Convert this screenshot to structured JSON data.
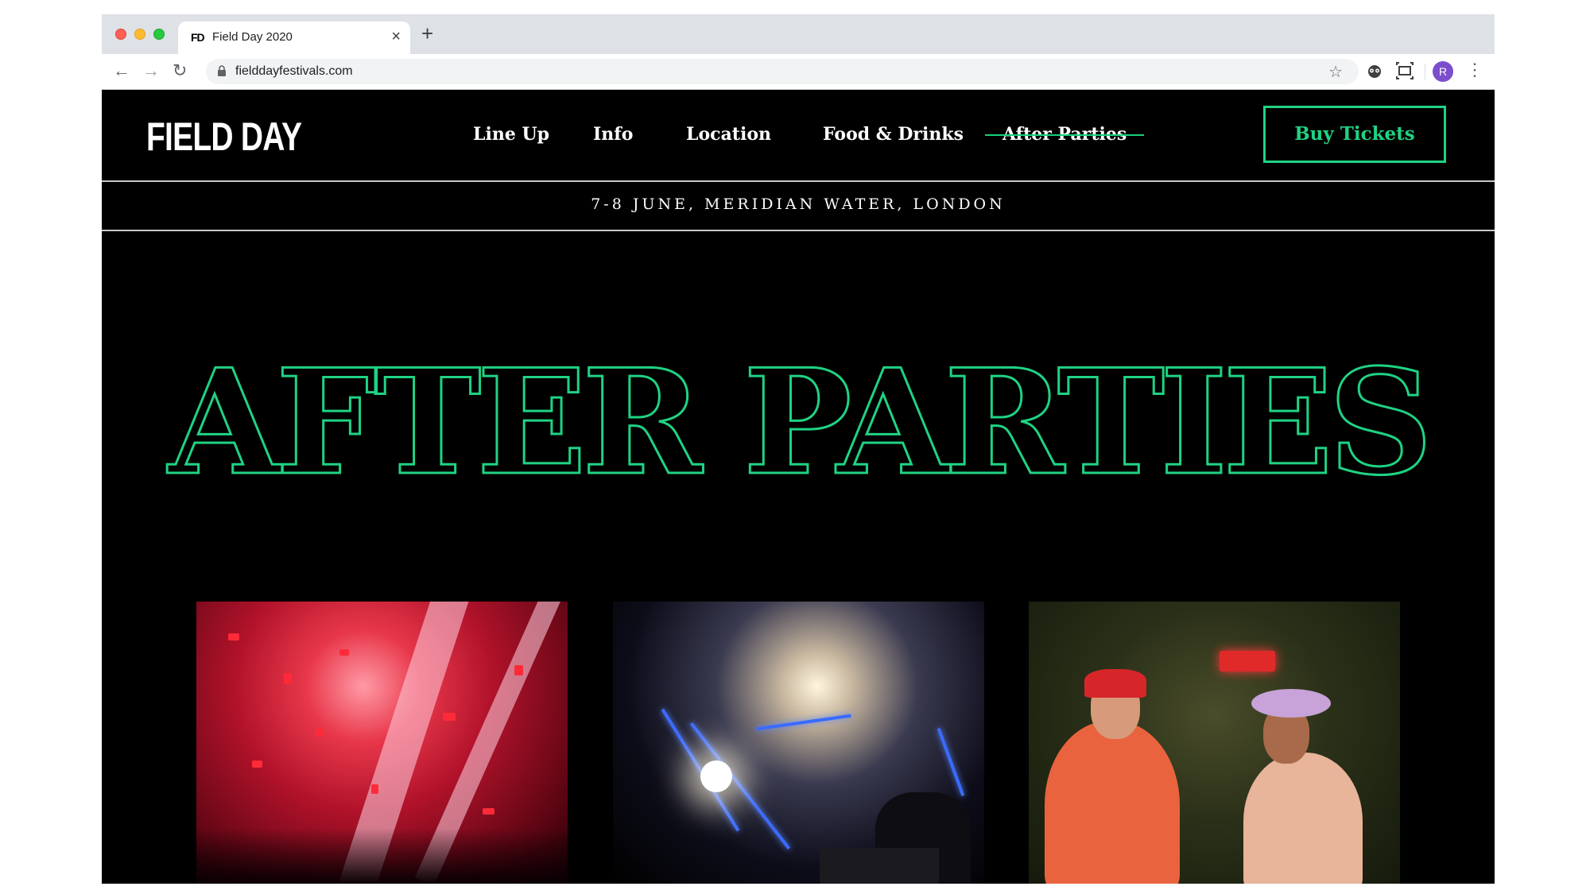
{
  "browser": {
    "tab_favicon": "FD",
    "tab_title": "Field Day 2020",
    "tab_close": "×",
    "new_tab": "+",
    "back": "←",
    "forward": "→",
    "reload": "↻",
    "url": "fielddayfestivals.com",
    "bookmark_star": "☆",
    "profile_initial": "R",
    "menu": "⋮"
  },
  "site": {
    "logo": "FIELD DAY",
    "nav": [
      {
        "label": "Line Up"
      },
      {
        "label": "Info"
      },
      {
        "label": "Location"
      },
      {
        "label": "Food & Drinks"
      },
      {
        "label": "After Parties"
      }
    ],
    "active_nav": "After Parties",
    "cta": "Buy Tickets",
    "dateline": "7-8 JUNE, MERIDIAN WATER, LONDON",
    "hero_title": "AFTER PARTIES"
  },
  "colors": {
    "accent": "#1fd383",
    "background": "#000000",
    "text": "#ffffff"
  },
  "icons": [
    "lock-icon",
    "star-icon",
    "extension-icon",
    "screenshot-icon",
    "kebab-menu-icon"
  ]
}
